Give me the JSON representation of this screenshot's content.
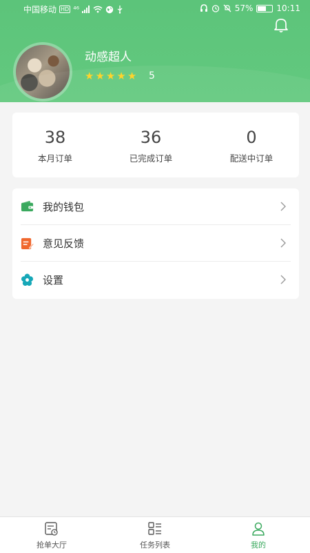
{
  "status_bar": {
    "carrier": "中国移动",
    "hd_badge": "HD",
    "signal_label": "⁴⁶",
    "battery_percent": "57%",
    "battery_level": 0.57,
    "time": "10:11"
  },
  "profile": {
    "username": "动感超人",
    "rating": "5",
    "stars_filled": 5,
    "stars_total": 5
  },
  "stats": [
    {
      "value": "38",
      "label": "本月订单"
    },
    {
      "value": "36",
      "label": "已完成订单"
    },
    {
      "value": "0",
      "label": "配送中订单"
    }
  ],
  "menu": {
    "items": [
      {
        "label": "我的钱包",
        "icon": "wallet-icon",
        "color": "#3aa95e"
      },
      {
        "label": "意见反馈",
        "icon": "feedback-icon",
        "color": "#f0672d"
      },
      {
        "label": "设置",
        "icon": "settings-icon",
        "color": "#17a8b8"
      }
    ]
  },
  "tabbar": {
    "tabs": [
      {
        "label": "抢单大厅",
        "icon": "order-hall-icon",
        "active": false
      },
      {
        "label": "任务列表",
        "icon": "task-list-icon",
        "active": false
      },
      {
        "label": "我的",
        "icon": "profile-icon",
        "active": true
      }
    ]
  },
  "colors": {
    "header": "#5cc47a",
    "accent": "#3aa95e",
    "star": "#ffd21f",
    "background": "#f4f4f4"
  }
}
